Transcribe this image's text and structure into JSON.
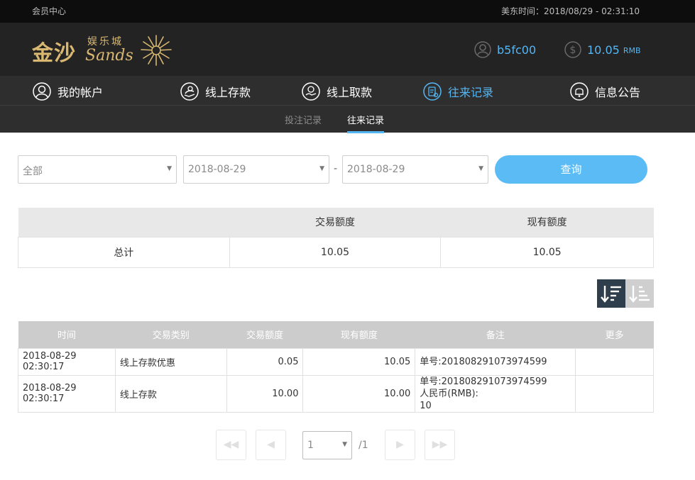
{
  "topbar": {
    "member_center": "会员中心",
    "time_text": "美东时间：2018/08/29 - 02:31:10"
  },
  "logo": {
    "cn": "金沙",
    "small": "娱乐城",
    "en": "Sands"
  },
  "user": {
    "username": "b5fc00",
    "balance": "10.05",
    "currency": "RMB"
  },
  "nav": {
    "items": [
      {
        "label": "我的帐户",
        "icon": "user-icon"
      },
      {
        "label": "线上存款",
        "icon": "deposit-icon"
      },
      {
        "label": "线上取款",
        "icon": "withdraw-icon"
      },
      {
        "label": "往来记录",
        "icon": "records-icon"
      },
      {
        "label": "信息公告",
        "icon": "bell-icon"
      }
    ],
    "active": "往来记录"
  },
  "subnav": {
    "items": [
      "投注记录",
      "往来记录"
    ],
    "active": "往来记录"
  },
  "filter": {
    "type": "全部",
    "start_date": "2018-08-29",
    "end_date": "2018-08-29",
    "separator": "-",
    "query_label": "查询"
  },
  "summary": {
    "headers": [
      "",
      "交易额度",
      "现有额度"
    ],
    "row": [
      "总计",
      "10.05",
      "10.05"
    ]
  },
  "records": {
    "headers": [
      "时间",
      "交易类别",
      "交易额度",
      "现有额度",
      "备注",
      "更多"
    ],
    "rows": [
      {
        "time": "2018-08-29 02:30:17",
        "type": "线上存款优惠",
        "amount": "0.05",
        "balance": "10.05",
        "note": [
          "单号:201808291073974599"
        ],
        "more": ""
      },
      {
        "time": "2018-08-29 02:30:17",
        "type": "线上存款",
        "amount": "10.00",
        "balance": "10.00",
        "note": [
          "单号:201808291073974599",
          "人民币(RMB):",
          "10"
        ],
        "more": ""
      }
    ]
  },
  "pagination": {
    "current": "1",
    "total": "/1"
  },
  "colors": {
    "accent": "#55b6f3",
    "header_bg": "#232323",
    "nav_bg": "#2e2e2e",
    "sort_active": "#2e3e4c"
  }
}
